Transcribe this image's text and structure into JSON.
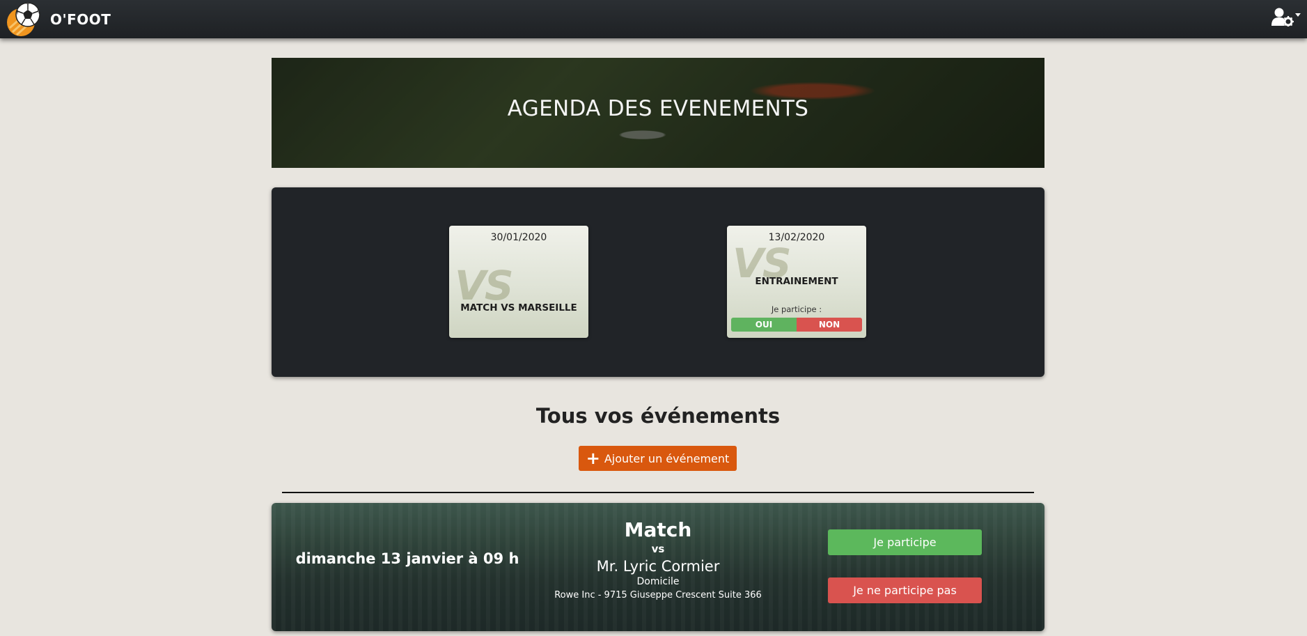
{
  "navbar": {
    "brand": "O'FOOT",
    "logo_icon": "soccer-ball-icon",
    "user_icon": "user-settings-icon"
  },
  "hero": {
    "title": "AGENDA DES EVENEMENTS"
  },
  "upcoming": [
    {
      "date": "30/01/2020",
      "title": "MATCH VS MARSEILLE"
    },
    {
      "date": "13/02/2020",
      "title": "ENTRAINEMENT",
      "participate_label": "Je participe :",
      "yes_label": "OUI",
      "no_label": "NON"
    }
  ],
  "section": {
    "title": "Tous vos événements",
    "add_button": "Ajouter un événement"
  },
  "events": [
    {
      "date": "dimanche 13 janvier à 09 h",
      "type": "Match",
      "vs": "vs",
      "opponent": "Mr. Lyric Cormier",
      "location": "Domicile",
      "address": "Rowe Inc - 9715 Giuseppe Crescent Suite 366",
      "join_label": "Je participe",
      "decline_label": "Je ne participe pas"
    }
  ],
  "colors": {
    "navbar": "#212428",
    "accent": "#d9580e",
    "success": "#5cb85c",
    "danger": "#d9534f"
  }
}
